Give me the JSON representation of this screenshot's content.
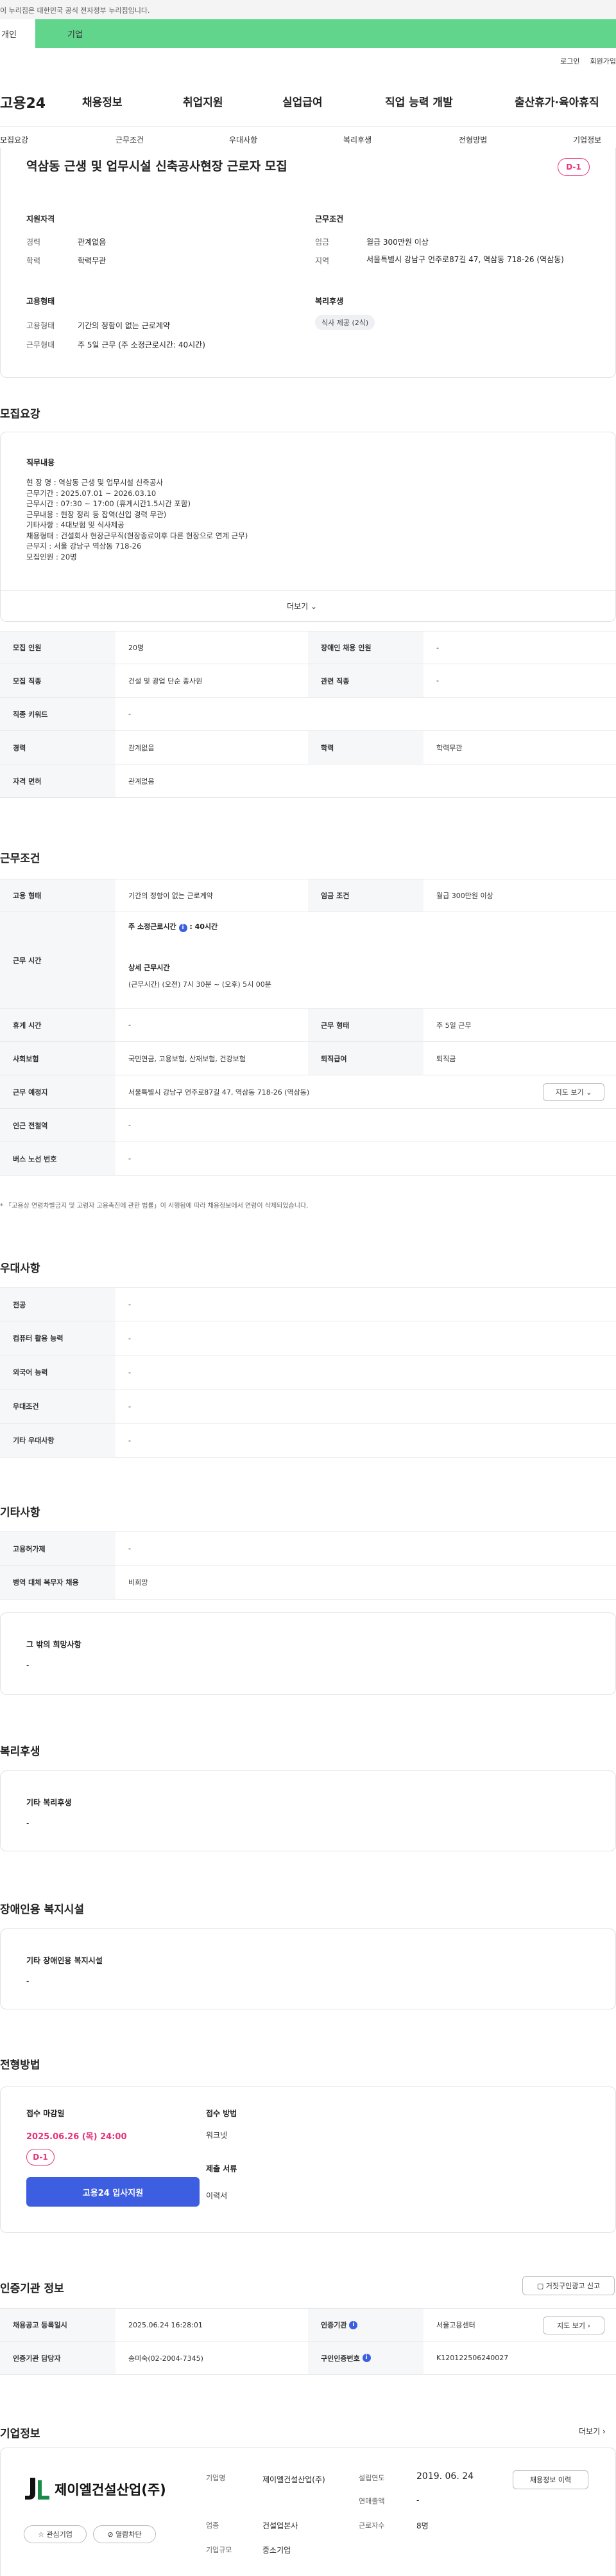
{
  "gov_notice": "이 누리집은 대한민국 공식 전자정부 누리집입니다.",
  "top_tabs": [
    "개인",
    "기업"
  ],
  "util": [
    "로그인",
    "회원가입"
  ],
  "gnb": {
    "logo": "고용24",
    "items": [
      "채용정보",
      "취업지원",
      "실업급여",
      "직업 능력 개발",
      "출산휴가·육아휴직"
    ]
  },
  "subnav": [
    "모집요강",
    "근무조건",
    "우대사항",
    "복리후생",
    "전형방법",
    "기업정보"
  ],
  "summary": {
    "title": "역삼동 근생 및 업무시설 신축공사현장 근로자 모집",
    "dday": "D-1",
    "qual_head": "지원자격",
    "career_l": "경력",
    "career_v": "관계없음",
    "edu_l": "학력",
    "edu_v": "학력무관",
    "cond_head": "근무조건",
    "wage_l": "임금",
    "wage_v": "월급 300만원 이상",
    "area_l": "지역",
    "area_v": "서울특별시 강남구 언주로87길 47, 역삼동 718-26 (역삼동)",
    "emp_head": "고용형태",
    "emp_l": "고용형태",
    "emp_v": "기간의 정함이 없는 근로계약",
    "work_l": "근무형태",
    "work_v": "주 5일 근무 (주 소정근로시간: 40시간)",
    "welfare_head": "복리후생",
    "welfare_tag": "식사 제공 (2식)"
  },
  "recruit": {
    "heading": "모집요강",
    "duty_head": "직무내용",
    "duty_lines": [
      "현 장 명 : 역삼동 근생 및 업무시설 신축공사",
      "근무기간 : 2025.07.01 ~ 2026.03.10",
      "근무시간 : 07:30 ~ 17:00 (휴게시간1.5시간 포함)",
      "근무내용 : 현장 정리 등 잡역(신입 경력 무관)",
      "기타사항 : 4대보험 및 식사제공",
      "채용형태 : 건설회사 현장근무직(현장종료이후 다른 현장으로 연계 근무)",
      "근무지 : 서울 강남구 역삼동 718-26",
      "모집인원 : 20명"
    ],
    "more": "더보기",
    "rows": [
      [
        "모집 인원",
        "20명",
        "장애인 채용 인원",
        "-"
      ],
      [
        "모집 직종",
        "건설 및 광업 단순 종사원",
        "관련 직종",
        "-"
      ],
      [
        "직종 키워드",
        "-",
        "",
        ""
      ],
      [
        "경력",
        "관계없음",
        "학력",
        "학력무관"
      ],
      [
        "자격 면허",
        "관계없음",
        "",
        ""
      ]
    ]
  },
  "conditions": {
    "heading": "근무조건",
    "emp_l": "고용 형태",
    "emp_v": "기간의 정함이 없는 근로계약",
    "wage_l": "임금 조건",
    "wage_v": "월급 300만원 이상",
    "time_l": "근무 시간",
    "time_week": "주 소정근로시간",
    "time_hours": ": 40시간",
    "time_detail_h": "상세 근무시간",
    "time_detail_v": "(근무시간) (오전) 7시 30분 ~ (오후) 5시 00분",
    "rest_l": "휴게 시간",
    "rest_v": "-",
    "shift_l": "근무 형태",
    "shift_v": "주 5일 근무",
    "ins_l": "사회보험",
    "ins_v": "국민연금, 고용보험, 산재보험, 건강보험",
    "sev_l": "퇴직급여",
    "sev_v": "퇴직금",
    "place_l": "근무 예정지",
    "place_v": "서울특별시 강남구 언주로87길 47, 역삼동 718-26 (역삼동)",
    "map_btn": "지도 보기",
    "subway_l": "인근 전철역",
    "subway_v": "-",
    "bus_l": "버스 노선 번호",
    "bus_v": "-",
    "note": "* 「고용상 연령차별금지 및 고령자 고용촉진에 관한 법률」이 시행됨에 따라 채용정보에서 연령이 삭제되었습니다."
  },
  "pref": {
    "heading": "우대사항",
    "rows": [
      [
        "전공",
        "-"
      ],
      [
        "컴퓨터 활용 능력",
        "-"
      ],
      [
        "외국어 능력",
        "-"
      ],
      [
        "우대조건",
        "-"
      ],
      [
        "기타 우대사항",
        "-"
      ]
    ]
  },
  "etc": {
    "heading": "기타사항",
    "rows": [
      [
        "고용허가제",
        "-"
      ],
      [
        "병역 대체 복무자 채용",
        "비희망"
      ]
    ],
    "other_head": "그 밖의 희망사항",
    "other_v": "-"
  },
  "welfare": {
    "heading": "복리후생",
    "sub": "기타 복리후생",
    "v": "-"
  },
  "facility": {
    "heading": "장애인용 복지시설",
    "sub": "기타 장애인용 복지시설",
    "v": "-"
  },
  "process": {
    "heading": "전형방법",
    "deadline_h": "접수 마감일",
    "deadline_v": "2025.06.26 (목) 24:00",
    "dday": "D-1",
    "apply_btn": "고용24 입사지원",
    "method_h": "접수 방법",
    "method_v": "워크넷",
    "docs_h": "제출 서류",
    "docs_v": "이력서"
  },
  "agency": {
    "heading": "인증기관 정보",
    "report_btn": "거짓구인광고 신고",
    "rows": [
      [
        "채용공고 등록일시",
        "2025.06.24 16:28:01",
        "인증기관",
        "서울고용센터"
      ],
      [
        "인증기관 담당자",
        "송미숙(02-2004-7345)",
        "구인인증번호",
        "K120122506240027"
      ]
    ],
    "map_btn": "지도 보기"
  },
  "company": {
    "heading": "기업정보",
    "more": "더보기",
    "logo": "제이엘건설산업(주)",
    "fav_btn": "관심기업",
    "block_btn": "열람차단",
    "name_l": "기업명",
    "name_v": "제이엘건설산업(주)",
    "ind_l": "업종",
    "ind_v": "건설업본사",
    "size_l": "기업규모",
    "size_v": "중소기업",
    "est_l": "설립연도",
    "est_v": "2019. 06. 24",
    "rev_l": "연매출액",
    "rev_v": "-",
    "emp_l": "근로자수",
    "emp_v": "8명",
    "jobs_btn": "채용정보 이력"
  },
  "colors": {
    "accent": "#62d58d",
    "brand_blue": "#3d5ee1",
    "dday": "#e6337a"
  }
}
